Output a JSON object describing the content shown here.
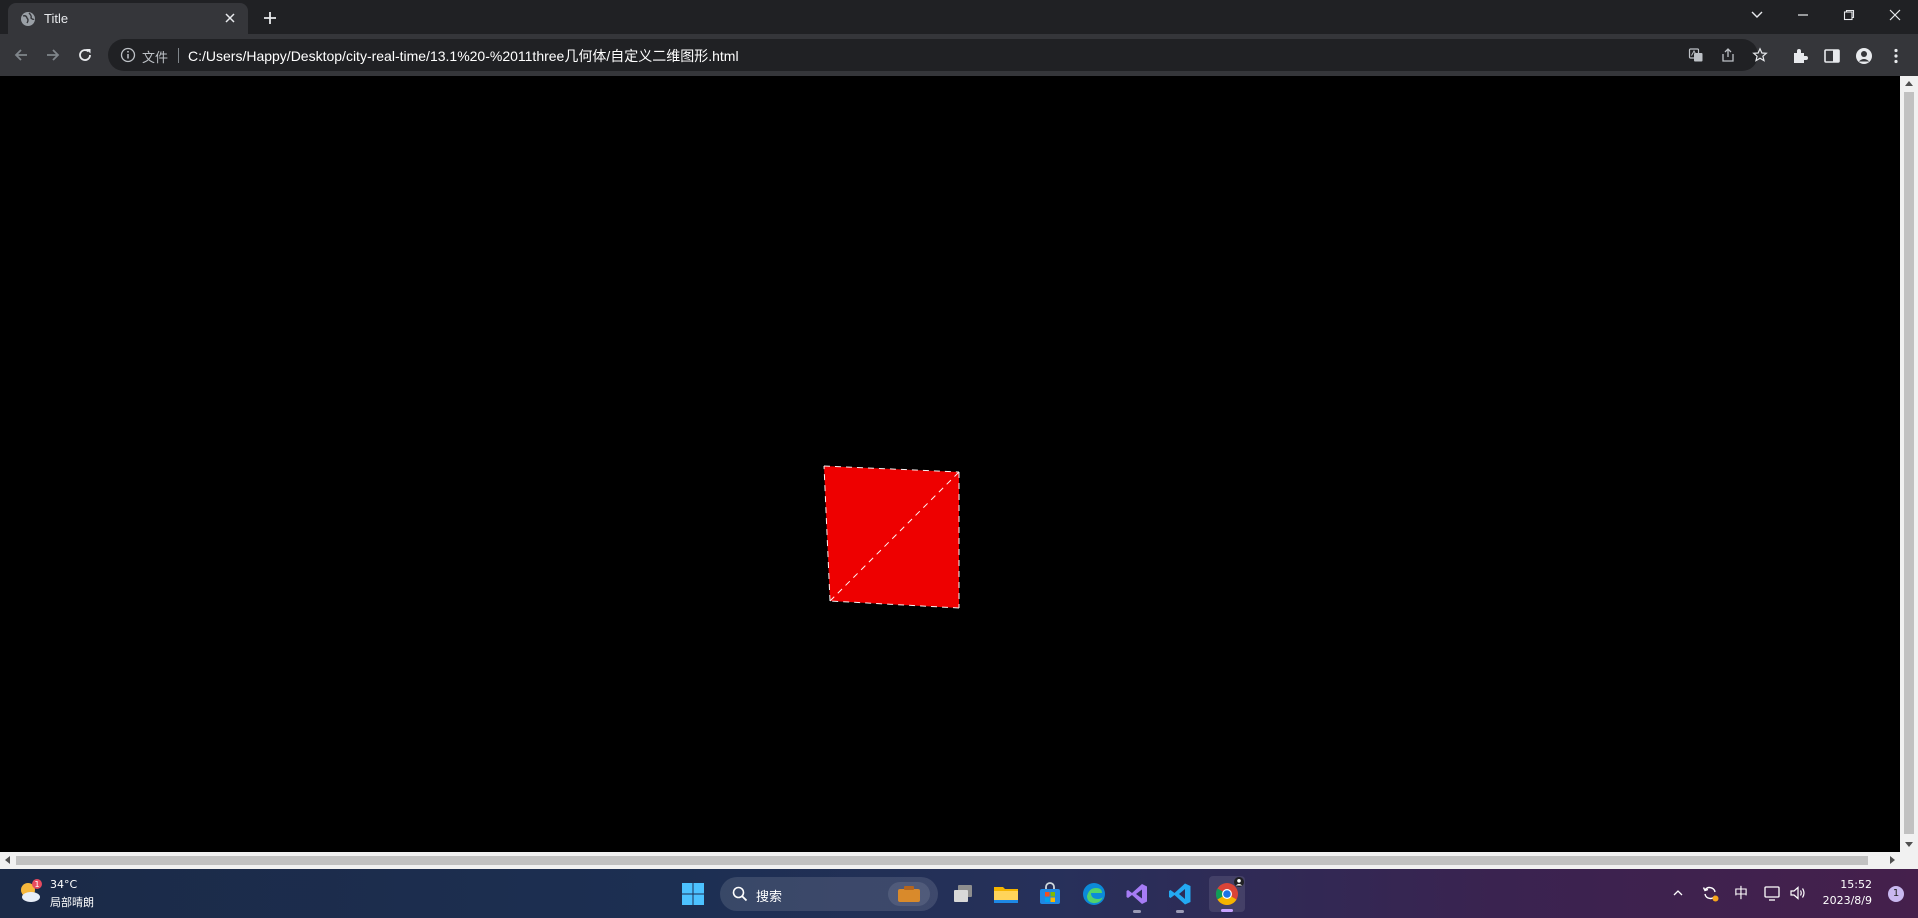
{
  "browser": {
    "tab": {
      "title": "Title"
    },
    "address": {
      "security_chip": "文件",
      "url": "C:/Users/Happy/Desktop/city-real-time/13.1%20-%2011three几何体/自定义二维图形.html"
    }
  },
  "scene": {
    "background": "#000000",
    "mesh_color": "#ee0000",
    "wire_color": "#ffffff"
  },
  "taskbar": {
    "weather": {
      "temperature": "34°C",
      "condition": "局部晴朗",
      "badge": "1"
    },
    "search": {
      "label": "搜索"
    },
    "tray": {
      "ime": "中"
    },
    "clock": {
      "time": "15:52",
      "date": "2023/8/9"
    },
    "notification_count": "1"
  },
  "colors": {
    "tabstrip": "#202124",
    "toolbar": "#35363a",
    "omnibox": "#202124",
    "accent_blue": "#1a73e8"
  }
}
